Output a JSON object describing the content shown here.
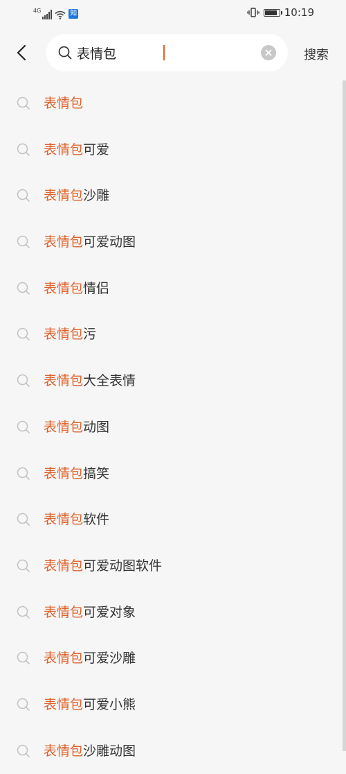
{
  "status_bar": {
    "network": "4G",
    "app_badge": "知",
    "time": "10:19",
    "battery_level": 0.9
  },
  "search": {
    "query": "表情包",
    "placeholder": "",
    "button_label": "搜索"
  },
  "suggestions": [
    {
      "highlight": "表情包",
      "rest": ""
    },
    {
      "highlight": "表情包",
      "rest": "可爱"
    },
    {
      "highlight": "表情包",
      "rest": "沙雕"
    },
    {
      "highlight": "表情包",
      "rest": "可爱动图"
    },
    {
      "highlight": "表情包",
      "rest": "情侣"
    },
    {
      "highlight": "表情包",
      "rest": "污"
    },
    {
      "highlight": "表情包",
      "rest": "大全表情"
    },
    {
      "highlight": "表情包",
      "rest": "动图"
    },
    {
      "highlight": "表情包",
      "rest": "搞笑"
    },
    {
      "highlight": "表情包",
      "rest": "软件"
    },
    {
      "highlight": "表情包",
      "rest": "可爱动图软件"
    },
    {
      "highlight": "表情包",
      "rest": "可爱对象"
    },
    {
      "highlight": "表情包",
      "rest": "可爱沙雕"
    },
    {
      "highlight": "表情包",
      "rest": "可爱小熊"
    },
    {
      "highlight": "表情包",
      "rest": "沙雕动图"
    }
  ],
  "colors": {
    "accent": "#e0622a",
    "background": "#f6f6f6",
    "text": "#333333"
  }
}
